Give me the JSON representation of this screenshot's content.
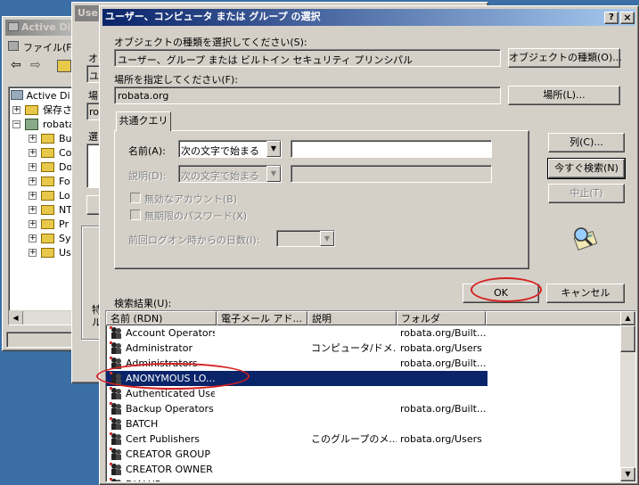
{
  "bg_window": {
    "title": "Active Di",
    "menu_file": "ファイル(F)",
    "tree": [
      {
        "label": "Active Di"
      },
      {
        "label": "保存さ"
      },
      {
        "label": "robata"
      },
      {
        "label": "Bu"
      },
      {
        "label": "Co"
      },
      {
        "label": "Do"
      },
      {
        "label": "Fo"
      },
      {
        "label": "Lo"
      },
      {
        "label": "NT"
      },
      {
        "label": "Pr"
      },
      {
        "label": "Sy"
      },
      {
        "label": "Us"
      }
    ]
  },
  "mid_window": {
    "title": "User",
    "frag1": "オ",
    "frag2": "ユ",
    "frag3": "場",
    "frag4": "ro",
    "frag5": "選",
    "frag6": "特",
    "frag7": "ル"
  },
  "dialog": {
    "title": "ユーザー、コンピュータ または グループ の選択",
    "help_button": "?",
    "close_button": "×",
    "object_type_label": "オブジェクトの種類を選択してください(S):",
    "object_type_value": "ユーザー、グループ または ビルトイン セキュリティ プリンシパル",
    "object_type_button": "オブジェクトの種類(O)...",
    "location_label": "場所を指定してください(F):",
    "location_value": "robata.org",
    "location_button": "場所(L)...",
    "tab_label": "共通クエリ",
    "name_label": "名前(A):",
    "name_mode": "次の文字で始まる",
    "name_value": "",
    "desc_label": "説明(D):",
    "desc_mode": "次の文字で始まる",
    "desc_value": "",
    "disabled_accounts": "無効なアカウント(B)",
    "no_expire_pw": "無期限のパスワード(X)",
    "days_since_logon": "前回ログオン時からの日数(I):",
    "days_value": "",
    "columns_button": "列(C)...",
    "search_now_button": "今すぐ検索(N)",
    "stop_button": "中止(T)",
    "results_label": "検索結果(U):",
    "ok_button": "OK",
    "cancel_button": "キャンセル",
    "headers": [
      "名前 (RDN)",
      "電子メール アド...",
      "説明",
      "フォルダ"
    ],
    "rows": [
      {
        "name": "Account Operators",
        "email": "",
        "desc": "",
        "folder": "robata.org/Built..."
      },
      {
        "name": "Administrator",
        "email": "",
        "desc": "コンピュータ/ドメ...",
        "folder": "robata.org/Users"
      },
      {
        "name": "Administrators",
        "email": "",
        "desc": "",
        "folder": "robata.org/Built..."
      },
      {
        "name": "ANONYMOUS LO...",
        "email": "",
        "desc": "",
        "folder": ""
      },
      {
        "name": "Authenticated Use...",
        "email": "",
        "desc": "",
        "folder": ""
      },
      {
        "name": "Backup Operators",
        "email": "",
        "desc": "",
        "folder": "robata.org/Built..."
      },
      {
        "name": "BATCH",
        "email": "",
        "desc": "",
        "folder": ""
      },
      {
        "name": "Cert Publishers",
        "email": "",
        "desc": "このグループのメ...",
        "folder": "robata.org/Users"
      },
      {
        "name": "CREATOR GROUP",
        "email": "",
        "desc": "",
        "folder": ""
      },
      {
        "name": "CREATOR OWNER",
        "email": "",
        "desc": "",
        "folder": ""
      },
      {
        "name": "DIALUP",
        "email": "",
        "desc": "",
        "folder": ""
      }
    ],
    "selected_row_index": 3
  },
  "colors": {
    "desktop": "#3a6ea5",
    "face": "#d4d0c8",
    "selection": "#0a246a",
    "annotation": "#d42020"
  }
}
